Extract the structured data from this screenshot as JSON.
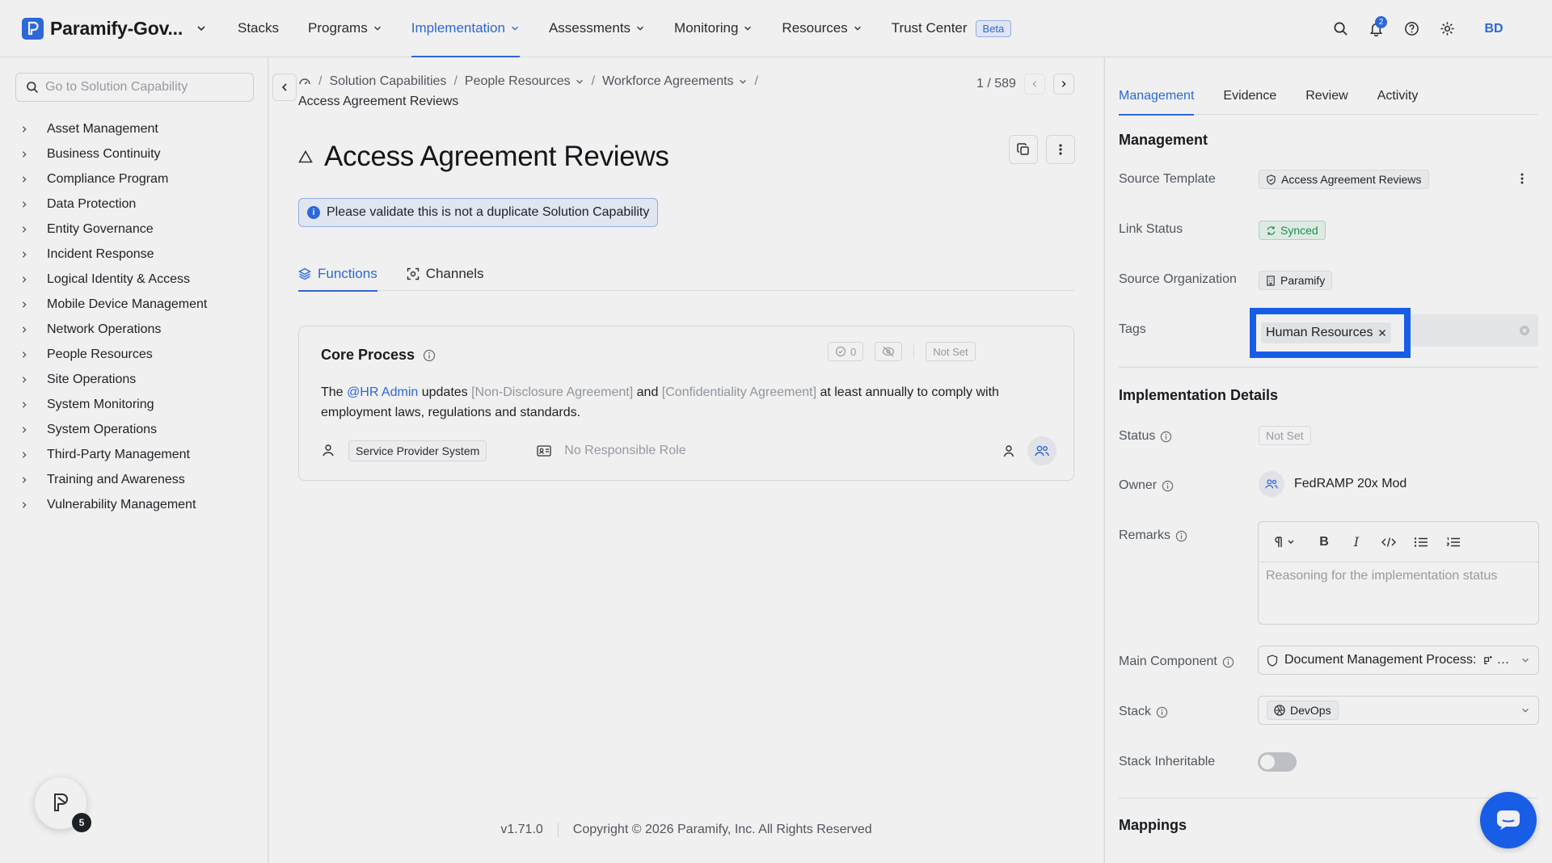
{
  "app": {
    "org_name": "Paramify-Gov...",
    "avatar_initials": "BD",
    "notification_count": "2"
  },
  "nav": {
    "items": [
      {
        "label": "Stacks",
        "has_menu": false,
        "active": false
      },
      {
        "label": "Programs",
        "has_menu": true,
        "active": false
      },
      {
        "label": "Implementation",
        "has_menu": true,
        "active": true
      },
      {
        "label": "Assessments",
        "has_menu": true,
        "active": false
      },
      {
        "label": "Monitoring",
        "has_menu": true,
        "active": false
      },
      {
        "label": "Resources",
        "has_menu": true,
        "active": false
      },
      {
        "label": "Trust Center",
        "has_menu": false,
        "active": false
      }
    ],
    "beta_label": "Beta"
  },
  "sidebar": {
    "search_placeholder": "Go to Solution Capability",
    "items": [
      "Asset Management",
      "Business Continuity",
      "Compliance Program",
      "Data Protection",
      "Entity Governance",
      "Incident Response",
      "Logical Identity & Access",
      "Mobile Device Management",
      "Network Operations",
      "People Resources",
      "Site Operations",
      "System Monitoring",
      "System Operations",
      "Third-Party Management",
      "Training and Awareness",
      "Vulnerability Management"
    ],
    "help_badge": "5"
  },
  "breadcrumb": {
    "items": [
      "Solution Capabilities",
      "People Resources",
      "Workforce Agreements"
    ],
    "current": "Access Agreement Reviews"
  },
  "pager": {
    "text": "1 / 589"
  },
  "page": {
    "title": "Access Agreement Reviews",
    "banner": "Please validate this is not a duplicate Solution Capability"
  },
  "tabs": [
    "Functions",
    "Channels"
  ],
  "card": {
    "title": "Core Process",
    "count": "0",
    "status": "Not Set",
    "body": {
      "pre": "The ",
      "mention": "@HR Admin",
      "mid1": " updates ",
      "doc1": "[Non-Disclosure Agreement]",
      "mid2": " and ",
      "doc2": "[Confidentiality Agreement]",
      "post": " at least annually to comply with employment laws, regulations and standards."
    },
    "system_chip": "Service Provider System",
    "role": "No Responsible Role"
  },
  "footer": {
    "version": "v1.71.0",
    "copyright": "Copyright © 2026 Paramify, Inc. All Rights Reserved"
  },
  "right_panel": {
    "tabs": [
      "Management",
      "Evidence",
      "Review",
      "Activity"
    ],
    "management_title": "Management",
    "source_template_label": "Source Template",
    "source_template_value": "Access Agreement Reviews",
    "link_status_label": "Link Status",
    "link_status_value": "Synced",
    "source_org_label": "Source Organization",
    "source_org_value": "Paramify",
    "tags_label": "Tags",
    "tag_value": "Human Resources",
    "impl_title": "Implementation Details",
    "status_label": "Status",
    "status_value": "Not Set",
    "owner_label": "Owner",
    "owner_value": "FedRAMP 20x Mod",
    "remarks_label": "Remarks",
    "remarks_placeholder": "Reasoning for the implementation status",
    "main_component_label": "Main Component",
    "main_component_value": "Document Management Process:",
    "stack_label": "Stack",
    "stack_value": "DevOps",
    "stack_inheritable_label": "Stack Inheritable",
    "stack_inheritable_on": false,
    "mappings_title": "Mappings"
  },
  "colors": {
    "accent": "#2f6fe4",
    "highlight": "#1a63f5",
    "synced": "#1a9a55"
  }
}
